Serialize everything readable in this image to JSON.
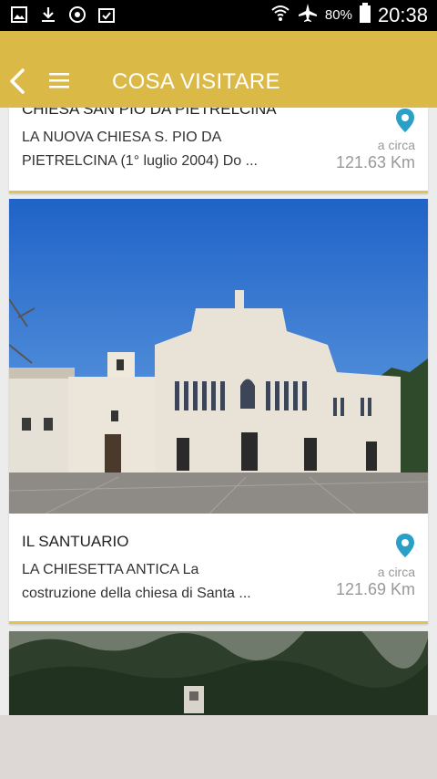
{
  "status": {
    "battery": "80%",
    "time": "20:38"
  },
  "header": {
    "title": "COSA VISITARE"
  },
  "items": [
    {
      "title": "CHIESA SAN PIO DA PIETRELCINA",
      "desc_line1": "LA NUOVA CHIESA S. PIO DA",
      "desc_line2": "PIETRELCINA (1° luglio 2004) Do ...",
      "distance_label": "a circa",
      "distance": "121.63 Km"
    },
    {
      "title": "IL SANTUARIO",
      "desc_line1": "LA CHIESETTA ANTICA La",
      "desc_line2": "costruzione della chiesa di Santa ...",
      "distance_label": "a circa",
      "distance": "121.69 Km"
    }
  ],
  "colors": {
    "appbar": "#dbb947",
    "accent_line": "#e0c25a",
    "pin": "#2a9fc7"
  }
}
